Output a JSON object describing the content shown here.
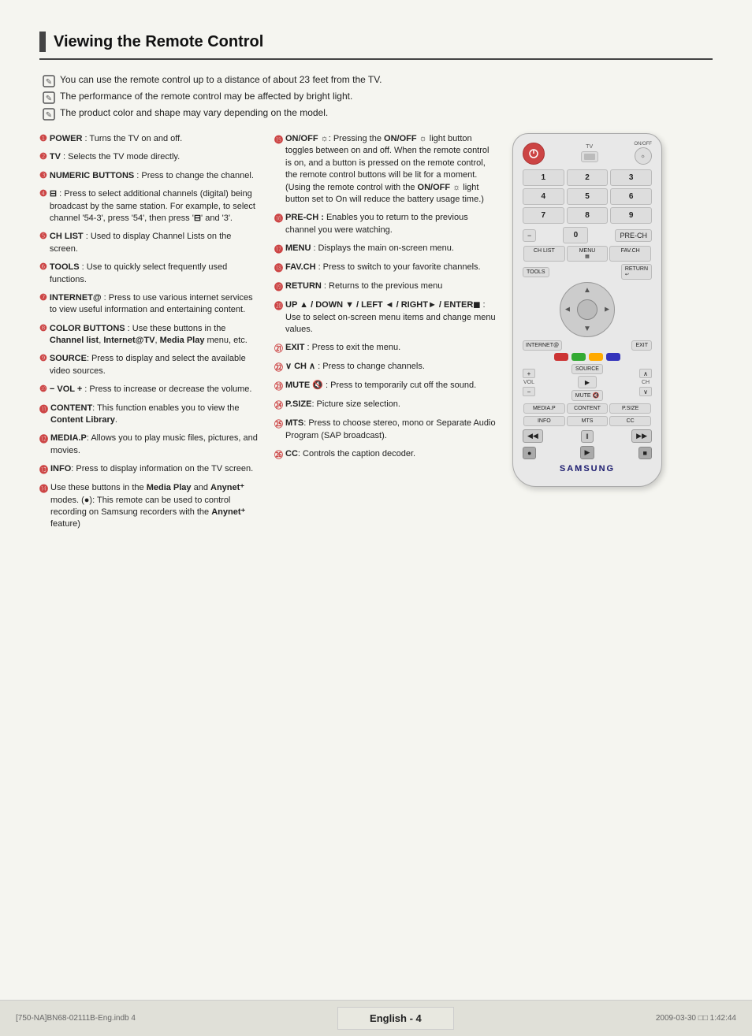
{
  "page": {
    "title": "Viewing the Remote Control",
    "footer_center": "English - 4",
    "footer_left": "[750-NA]BN68-02111B-Eng.indb   4",
    "footer_right": "2009-03-30   □□ 1:42:44"
  },
  "notes": [
    "You can use the remote control up to a distance of about 23 feet from the TV.",
    "The performance of the remote control may be affected by bright light.",
    "The product color and shape may vary depending on the model."
  ],
  "descriptions_col1": [
    {
      "num": "❶",
      "text": "POWER : Turns the TV on and off."
    },
    {
      "num": "❷",
      "text": "TV : Selects the TV mode directly."
    },
    {
      "num": "❸",
      "text": "NUMERIC BUTTONS : Press to change the channel."
    },
    {
      "num": "❹",
      "text": "⊟ : Press to select additional channels (digital) being broadcast by the same station. For example, to select channel '54-3', press '54', then press '⊟' and '3'."
    },
    {
      "num": "❺",
      "text": "CH LIST : Used to display Channel Lists on the screen."
    },
    {
      "num": "❻",
      "text": "TOOLS : Use to quickly select frequently used functions."
    },
    {
      "num": "❼",
      "text": "INTERNET@ : Press to use various internet services to view useful information and entertaining content."
    },
    {
      "num": "❽",
      "text": "COLOR BUTTONS : Use these buttons in the Channel list, Internet@TV, Media Play menu, etc."
    },
    {
      "num": "❾",
      "text": "SOURCE: Press to display and select the available video sources."
    },
    {
      "num": "❿",
      "text": "− VOL + : Press to increase or decrease the volume."
    },
    {
      "num": "⓫",
      "text": "CONTENT: This function enables you to view the Content Library."
    },
    {
      "num": "⓬",
      "text": "MEDIA.P: Allows you to play music files, pictures, and movies."
    },
    {
      "num": "⓭",
      "text": "INFO: Press to display information on the TV screen."
    },
    {
      "num": "⓮",
      "text": "Use these buttons in the Media Play and Anynet⁺ modes. (●): This remote can be used to control recording on Samsung recorders with the Anynet⁺ feature)"
    }
  ],
  "descriptions_col2": [
    {
      "num": "⓯",
      "text": "ON/OFF ☼ : Pressing the ON/OFF ☼ light button toggles between on and off. When the remote control is on, and a button is pressed on the remote control, the remote control buttons will be lit for a moment. (Using the remote control with the ON/OFF ☼ light button set to On will reduce the battery usage time.)"
    },
    {
      "num": "⓰",
      "text": "PRE-CH : Enables you to return to the previous channel you were watching."
    },
    {
      "num": "⓱",
      "text": "MENU : Displays the main on-screen menu."
    },
    {
      "num": "⓲",
      "text": "FAV.CH : Press to switch to your favorite channels."
    },
    {
      "num": "⓳",
      "text": "RETURN : Returns to the previous menu"
    },
    {
      "num": "⓴",
      "text": "UP ▲ / DOWN ▼ / LEFT ◄ / RIGHT► / ENTER◼ : Use to select on-screen menu items and change menu values."
    },
    {
      "num": "㉑",
      "text": "EXIT : Press to exit the menu."
    },
    {
      "num": "㉒",
      "text": "∨ CH ∧ : Press to change channels."
    },
    {
      "num": "㉓",
      "text": "MUTE 🔇 : Press to temporarily cut off the sound."
    },
    {
      "num": "㉔",
      "text": "P.SIZE: Picture size selection."
    },
    {
      "num": "㉕",
      "text": "MTS: Press to choose stereo, mono or Separate Audio Program (SAP broadcast)."
    },
    {
      "num": "㉖",
      "text": "CC: Controls the caption decoder."
    }
  ],
  "remote": {
    "samsung_label": "SAMSUNG",
    "power_label": "POWER",
    "tv_label": "TV",
    "onoff_label": "ON/OFF",
    "numbers": [
      "1",
      "2",
      "3",
      "4",
      "5",
      "6",
      "7",
      "8",
      "9",
      "0"
    ],
    "ch_list": "CH LIST",
    "menu": "MENU",
    "fav_ch": "FAV.CH",
    "tools": "TOOLS",
    "internet": "INTERNET@",
    "source": "SOURCE",
    "mute": "MUTE",
    "vol_label": "VOL",
    "ch_label": "CH",
    "content": "CONTENT",
    "media_p": "MEDIA.P",
    "info": "INFO",
    "pre_ch": "PRE-CH",
    "exit": "EXIT",
    "p_size": "P.SIZE",
    "mts": "MTS",
    "cc": "CC"
  }
}
